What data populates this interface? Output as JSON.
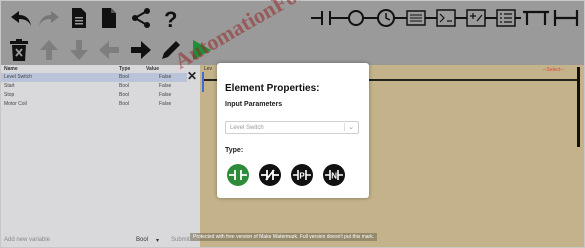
{
  "toolbar": {
    "row1": [
      "undo-icon",
      "redo-icon",
      "file-icon",
      "file-blank-icon",
      "share-icon",
      "help-icon"
    ],
    "row2": [
      "delete-icon",
      "arrow-up-icon",
      "arrow-down-icon",
      "arrow-left-icon",
      "arrow-right-icon",
      "edit-icon",
      "run-icon"
    ],
    "ladder_tools": [
      "contact-icon",
      "coil-icon",
      "timer-icon",
      "counter-icon",
      "compare-icon",
      "math-icon",
      "list-icon",
      "branch-icon",
      "rung-icon"
    ]
  },
  "variables": {
    "columns": [
      "Name",
      "Type",
      "Value"
    ],
    "rows": [
      {
        "name": "Level Switch",
        "type": "Bool",
        "value": "False"
      },
      {
        "name": "Start",
        "type": "Bool",
        "value": "False"
      },
      {
        "name": "Stop",
        "type": "Bool",
        "value": "False"
      },
      {
        "name": "Motor Coil",
        "type": "Bool",
        "value": "False"
      }
    ],
    "add_placeholder": "Add new variable",
    "add_type": "Bool",
    "add_button": "Submit"
  },
  "canvas": {
    "rung_label": "Lev",
    "select_tag": "--Select--"
  },
  "modal": {
    "title": "Element Properties:",
    "input_params": "Input Parameters",
    "select_value": "Level Switch",
    "type_label": "Type:",
    "types": [
      "NO",
      "NC",
      "P",
      "N"
    ],
    "active_type": "NO"
  },
  "watermark": "AutomationForum.co",
  "footer_note": "Protected with free version of Make Watermark. Full version doesn't put this mark.",
  "colors": {
    "toolbar": "#9a9a9a",
    "canvas": "#c4b38a",
    "active": "#2e8b3a",
    "rail": "#3a6fd8"
  }
}
